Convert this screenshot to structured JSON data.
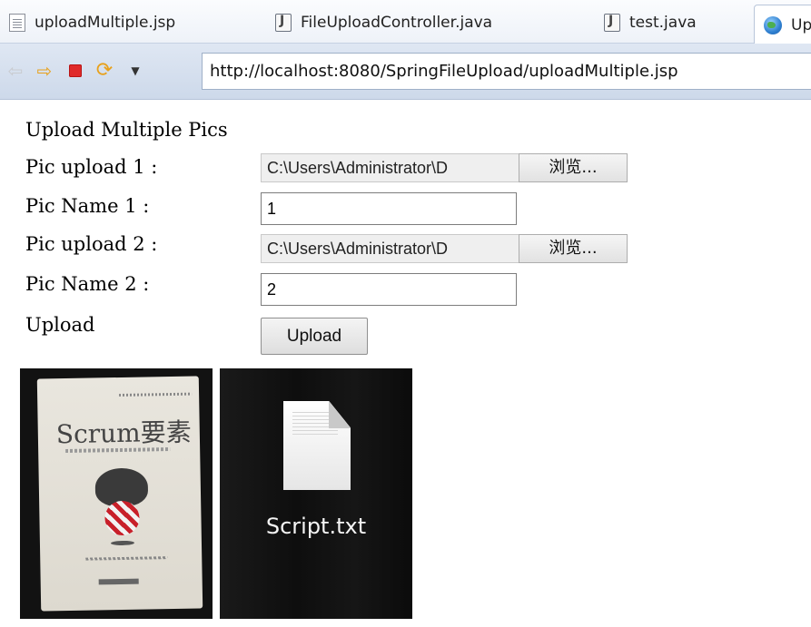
{
  "tabs": [
    {
      "label": "uploadMultiple.jsp",
      "icon": "jsp-file-icon"
    },
    {
      "label": "FileUploadController.java",
      "icon": "java-file-icon"
    },
    {
      "label": "test.java",
      "icon": "java-file-icon"
    },
    {
      "label": "Up",
      "icon": "globe-icon",
      "active": true
    }
  ],
  "nav": {
    "url": "http://localhost:8080/SpringFileUpload/uploadMultiple.jsp"
  },
  "form": {
    "title": "Upload Multiple Pics",
    "pic_upload_1_label": "Pic upload 1 :",
    "pic_upload_1_path": "C:\\Users\\Administrator\\D",
    "browse_label": "浏览...",
    "pic_name_1_label": "Pic Name 1 :",
    "pic_name_1_value": "1",
    "pic_upload_2_label": "Pic upload 2 :",
    "pic_upload_2_path": "C:\\Users\\Administrator\\D",
    "pic_name_2_label": "Pic Name 2 :",
    "pic_name_2_value": "2",
    "upload_label": "Upload",
    "upload_button": "Upload"
  },
  "images": {
    "book_title": "Scrum要素",
    "doc_label": "Script.txt"
  },
  "colors": {
    "tabbar_bg": "#eef2f8",
    "navbar_bg": "#cdd9ea",
    "stop_red": "#e02a2a",
    "arrow_orange": "#e8a11c"
  }
}
